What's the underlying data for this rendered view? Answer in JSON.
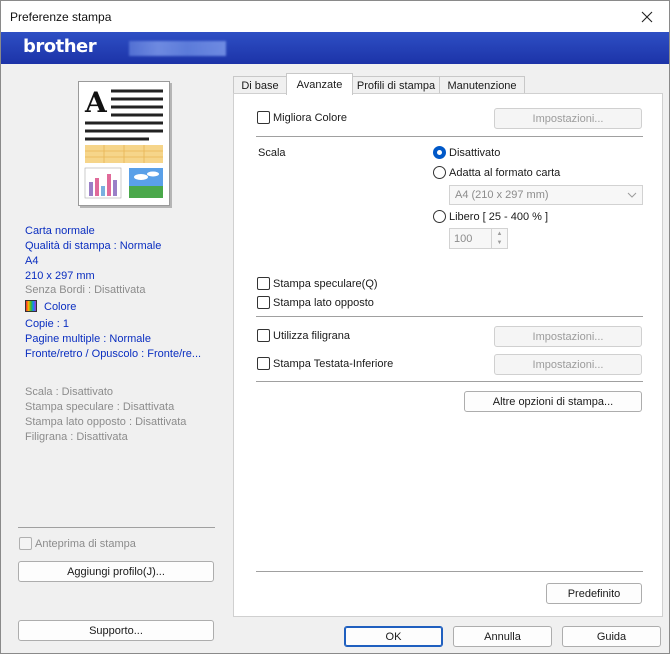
{
  "window": {
    "title": "Preferenze stampa"
  },
  "banner": {
    "brand": "brother"
  },
  "left": {
    "info_blue_1": [
      "Carta normale",
      "Qualità di stampa : Normale",
      "A4",
      "210 x 297 mm"
    ],
    "borderless": "Senza Bordi : Disattivata",
    "color_label": "Colore",
    "info_blue_2": [
      "Copie : 1",
      "Pagine multiple : Normale",
      "Fronte/retro / Opuscolo : Fronte/re..."
    ],
    "info_gray": [
      "Scala : Disattivato",
      "Stampa speculare : Disattivata",
      "Stampa lato opposto : Disattivata",
      "Filigrana : Disattivata"
    ],
    "preview_checkbox": "Anteprima di stampa",
    "add_profile_button": "Aggiungi profilo(J)...",
    "support_button": "Supporto..."
  },
  "tabs": [
    "Di base",
    "Avanzate",
    "Profili di stampa",
    "Manutenzione"
  ],
  "advanced": {
    "improve_color": "Migliora Colore",
    "settings_button": "Impostazioni...",
    "scale_label": "Scala",
    "scale_off": "Disattivato",
    "fit_to_paper": "Adatta al formato carta",
    "paper_size": "A4 (210 x 297 mm)",
    "free": "Libero [ 25 - 400 % ]",
    "free_value": "100",
    "mirror_print": "Stampa speculare(Q)",
    "reverse_print": "Stampa lato opposto",
    "watermark": "Utilizza filigrana",
    "header_footer": "Stampa Testata-Inferiore",
    "other_options": "Altre opzioni di stampa...",
    "default_button": "Predefinito"
  },
  "footer": {
    "ok": "OK",
    "cancel": "Annulla",
    "help": "Guida"
  },
  "colors": {
    "banner": "#1f37ad",
    "info_blue": "#0a2ec0",
    "radio_selected": "#0058c8"
  }
}
